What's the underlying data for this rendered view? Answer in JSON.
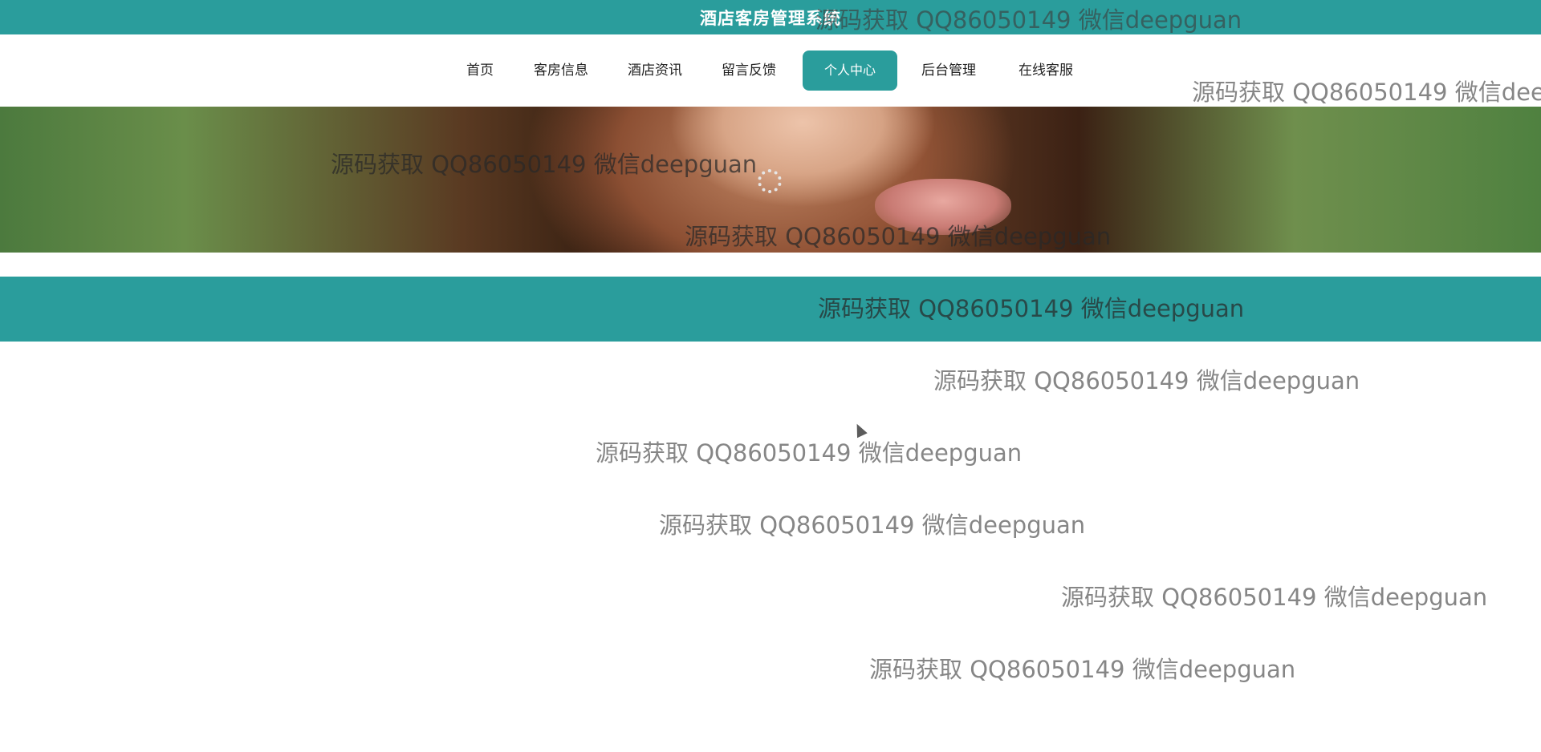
{
  "header": {
    "site_title": "酒店客房管理系统"
  },
  "nav": {
    "items": [
      {
        "label": "首页",
        "active": false
      },
      {
        "label": "客房信息",
        "active": false
      },
      {
        "label": "酒店资讯",
        "active": false
      },
      {
        "label": "留言反馈",
        "active": false
      },
      {
        "label": "个人中心",
        "active": true
      },
      {
        "label": "后台管理",
        "active": false
      },
      {
        "label": "在线客服",
        "active": false
      }
    ]
  },
  "watermark": {
    "text": "源码获取 QQ86050149 微信deepguan"
  },
  "colors": {
    "accent": "#2a9d9c",
    "background": "#ffffff"
  },
  "icons": {
    "loading": "loading-spinner-icon",
    "cursor": "mouse-cursor-icon"
  }
}
